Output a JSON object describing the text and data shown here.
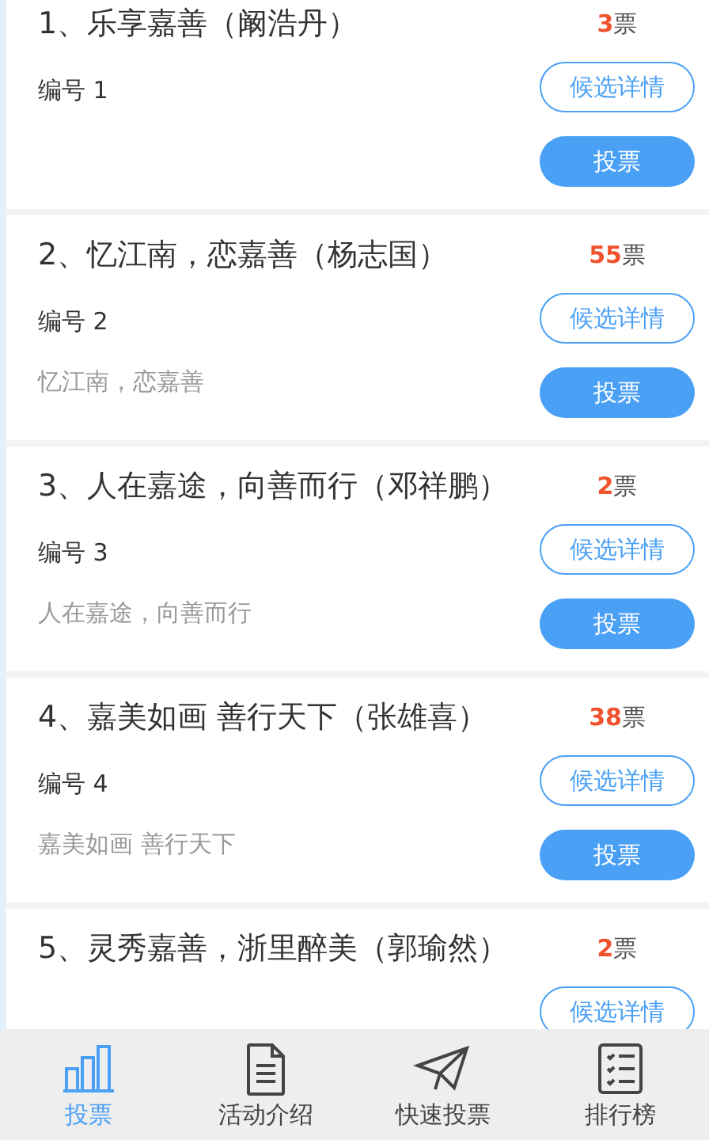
{
  "candidates": [
    {
      "title": "1、乐享嘉善（阚浩丹）",
      "votes": "3",
      "vote_unit": "票",
      "number": "编号 1",
      "details_button": "候选详情",
      "vote_button": "投票"
    },
    {
      "title": "2、忆江南，恋嘉善（杨志国）",
      "votes": "55",
      "vote_unit": "票",
      "number": "编号 2",
      "slogan": "忆江南，恋嘉善",
      "details_button": "候选详情",
      "vote_button": "投票"
    },
    {
      "title": "3、人在嘉途，向善而行（邓祥鹏）",
      "votes": "2",
      "vote_unit": "票",
      "number": "编号 3",
      "slogan": "人在嘉途，向善而行",
      "details_button": "候选详情",
      "vote_button": "投票"
    },
    {
      "title": "4、嘉美如画 善行天下（张雄喜）",
      "votes": "38",
      "vote_unit": "票",
      "number": "编号 4",
      "slogan": "嘉美如画 善行天下",
      "details_button": "候选详情",
      "vote_button": "投票"
    },
    {
      "title": "5、灵秀嘉善，浙里醉美（郭瑜然）",
      "votes": "2",
      "vote_unit": "票",
      "details_button": "候选详情"
    }
  ],
  "tab_bar": [
    {
      "kind": "chart",
      "label": "投票",
      "selected": true
    },
    {
      "kind": "document",
      "label": "活动介绍",
      "selected": false
    },
    {
      "kind": "plane",
      "label": "快速投票",
      "selected": false
    },
    {
      "kind": "list",
      "label": "排行榜",
      "selected": false
    }
  ]
}
